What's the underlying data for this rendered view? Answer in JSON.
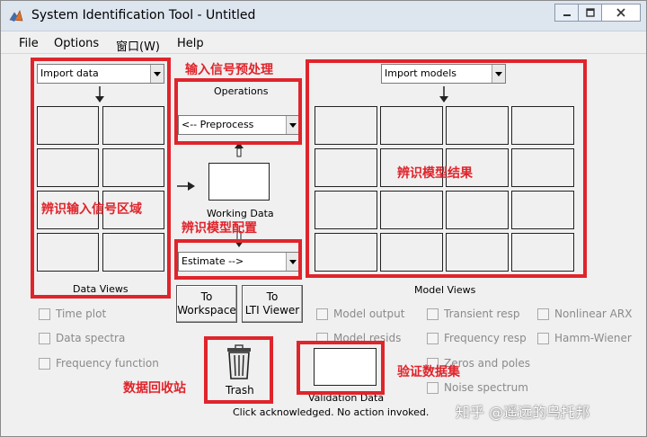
{
  "window": {
    "title": "System Identification Tool - Untitled"
  },
  "menu": [
    "File",
    "Options",
    "窗口(W)",
    "Help"
  ],
  "data_views": {
    "import_select": "Import data",
    "title": "Data Views"
  },
  "operations": {
    "title": "Operations",
    "preprocess_select": "<-- Preprocess",
    "working_data_label": "Working Data",
    "estimate_select": "Estimate -->"
  },
  "model_views": {
    "import_select": "Import models",
    "title": "Model Views"
  },
  "buttons": {
    "to_workspace": [
      "To",
      "Workspace"
    ],
    "to_lti_viewer": [
      "To",
      "LTI Viewer"
    ],
    "trash": "Trash",
    "validation_data": "Validation Data"
  },
  "data_checks": [
    "Time plot",
    "Data spectra",
    "Frequency function"
  ],
  "model_checks_col1": [
    "Model output",
    "Model resids"
  ],
  "model_checks_col2": [
    "Transient resp",
    "Frequency resp",
    "Zeros and poles",
    "Noise spectrum"
  ],
  "model_checks_col3": [
    "Nonlinear ARX",
    "Hamm-Wiener"
  ],
  "status": "Click acknowledged. No action invoked.",
  "annotations": {
    "preprocess": "输入信号预处理",
    "input_area": "辨识输入信号区域",
    "model_config": "辨识模型配置",
    "model_result": "辨识模型结果",
    "trash": "数据回收站",
    "validation": "验证数据集"
  },
  "watermark": "知乎 @遥远的乌托邦",
  "colors": {
    "annotation_red": "#e0242b",
    "titlebar": "#dde5ef",
    "panel": "#f0f0f0"
  }
}
